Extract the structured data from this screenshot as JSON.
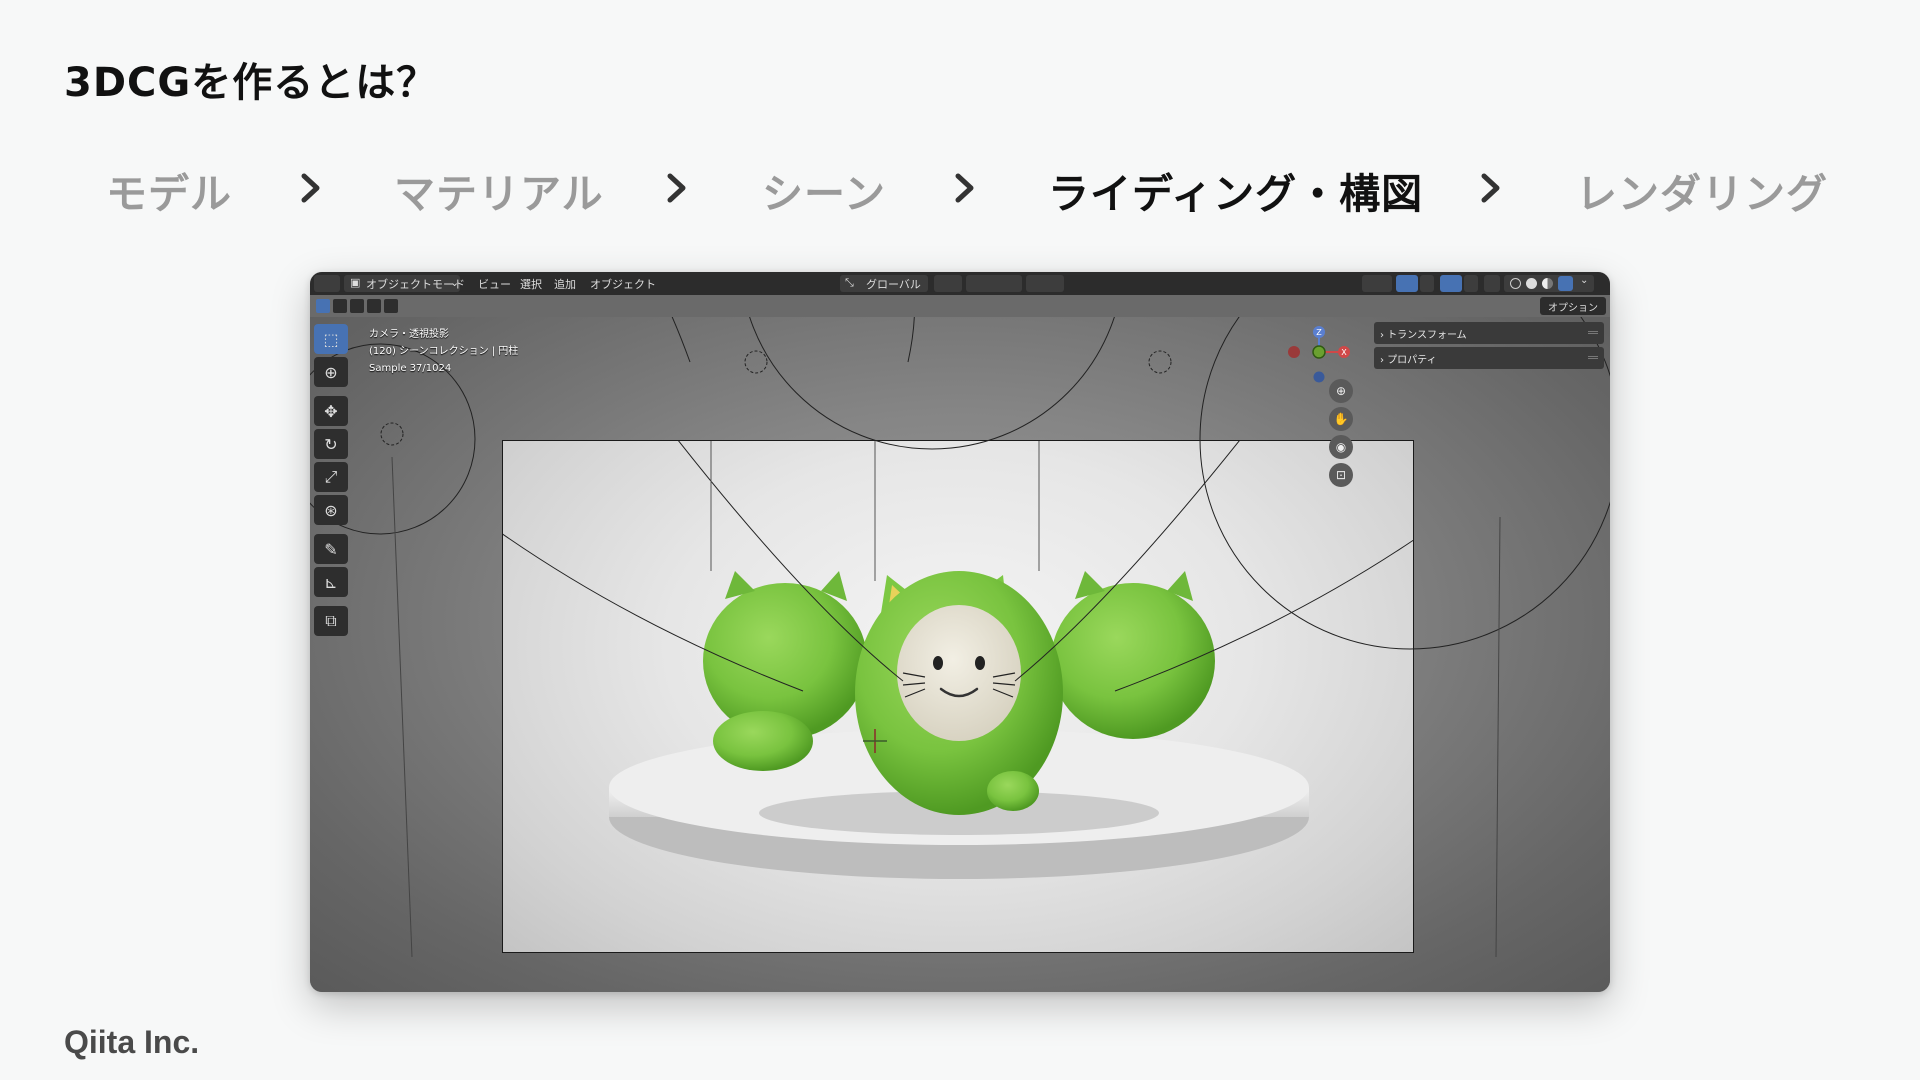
{
  "slide": {
    "title": "3DCGを作るとは？",
    "footer": "Qiita Inc."
  },
  "steps": [
    {
      "label": "モデル",
      "active": false
    },
    {
      "label": "マテリアル",
      "active": false
    },
    {
      "label": "シーン",
      "active": false
    },
    {
      "label": "ライディング・構図",
      "active": true
    },
    {
      "label": "レンダリング",
      "active": false
    }
  ],
  "blender": {
    "mode": "オブジェクトモード",
    "menu": [
      "ビュー",
      "選択",
      "追加",
      "オブジェクト"
    ],
    "orientation": "グローバル",
    "options_tab": "オプション",
    "viewport_info": {
      "view": "カメラ・透視投影",
      "collection": "(120) シーンコレクション | 円柱",
      "samples": "Sample 37/1024"
    },
    "n_panel": [
      "トランスフォーム",
      "プロパティ"
    ],
    "gizmo_axes": {
      "z": "Z",
      "x": "X"
    },
    "colors": {
      "header": "#2c2c2c",
      "active": "#4772b3",
      "model_green": "#7cc843"
    }
  }
}
